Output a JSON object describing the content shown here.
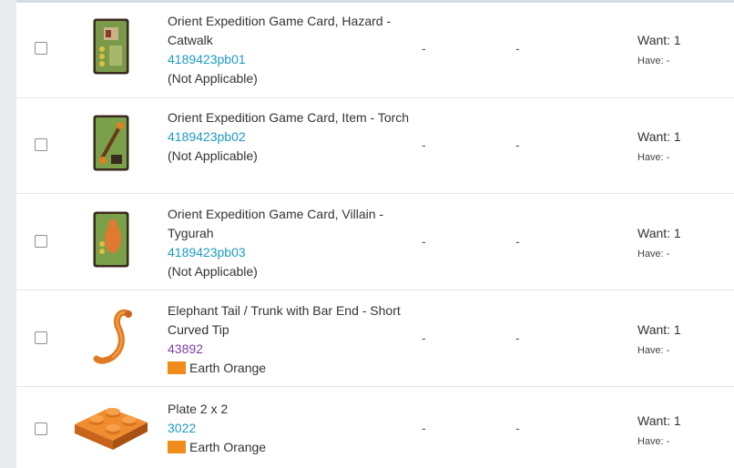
{
  "rows": [
    {
      "name": "Orient Expedition Game Card, Hazard - Catwalk",
      "number": "4189423pb01",
      "color_label": "(Not Applicable)",
      "col1": "-",
      "col2": "-",
      "want": "Want: 1",
      "have": "Have: -",
      "thumb_icon": "game-card-hazard"
    },
    {
      "name": "Orient Expedition Game Card, Item - Torch",
      "number": "4189423pb02",
      "color_label": "(Not Applicable)",
      "col1": "-",
      "col2": "-",
      "want": "Want: 1",
      "have": "Have: -",
      "thumb_icon": "game-card-item"
    },
    {
      "name": "Orient Expedition Game Card, Villain - Tygurah",
      "number": "4189423pb03",
      "color_label": "(Not Applicable)",
      "col1": "-",
      "col2": "-",
      "want": "Want: 1",
      "have": "Have: -",
      "thumb_icon": "game-card-villain"
    },
    {
      "name": "Elephant Tail / Trunk with Bar End - Short Curved Tip",
      "number": "43892",
      "color_label": "Earth Orange",
      "col1": "-",
      "col2": "-",
      "want": "Want: 1",
      "have": "Have: -",
      "thumb_icon": "elephant-trunk-part",
      "swatch_color": "#f08c1b"
    },
    {
      "name": "Plate 2 x 2",
      "number": "3022",
      "color_label": "Earth Orange",
      "col1": "-",
      "col2": "-",
      "want": "Want: 1",
      "have": "Have: -",
      "thumb_icon": "plate-2x2-part",
      "swatch_color": "#f08c1b"
    }
  ],
  "colors": {
    "link": "#1e9bc0",
    "link_visited": "#7a3fa5",
    "earth_orange": "#f08c1b"
  }
}
